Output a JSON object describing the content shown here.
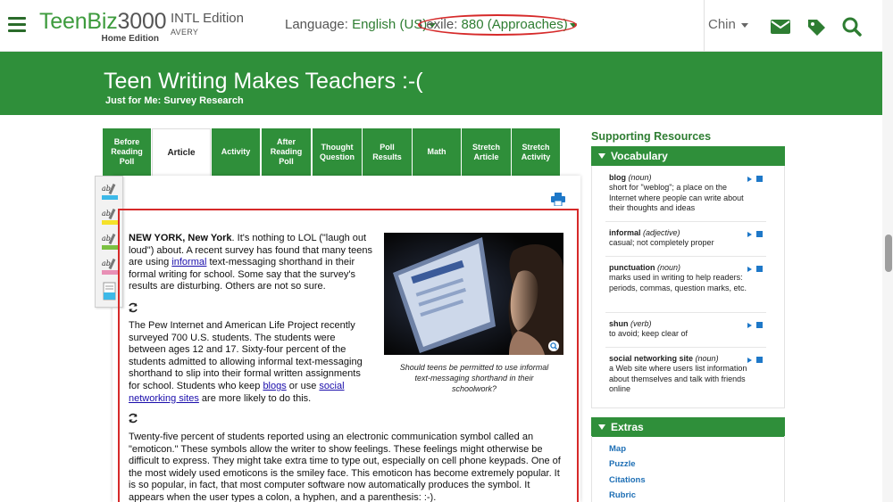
{
  "header": {
    "logo_main": "TeenBiz",
    "logo_num": "3000",
    "logo_sub": "Home Edition",
    "edition": "INTL Edition",
    "edition_sub": "AVERY",
    "language_label": "Language:",
    "language_value": "English (US)",
    "lexile_label": "Lexile:",
    "lexile_value": "880 (Approaches)",
    "user_name": "Chin",
    "icons": [
      "menu-icon",
      "mail-icon",
      "tag-icon",
      "search-icon"
    ]
  },
  "banner": {
    "title": "Teen Writing Makes Teachers :-(",
    "subtitle": "Just for Me: Survey Research"
  },
  "tabs": [
    {
      "label": "Before Reading Poll"
    },
    {
      "label": "Article"
    },
    {
      "label": "Activity"
    },
    {
      "label": "After Reading Poll"
    },
    {
      "label": "Thought Question"
    },
    {
      "label": "Poll Results"
    },
    {
      "label": "Math"
    },
    {
      "label": "Stretch Article"
    },
    {
      "label": "Stretch Activity"
    }
  ],
  "tools": {
    "colors": [
      "#3db9e8",
      "#f5e12a",
      "#7bc142",
      "#e88fb5",
      "#3db9e8"
    ]
  },
  "article": {
    "p1_dateline": "NEW YORK, New York",
    "p1_a": ". It's nothing to LOL (\"laugh out loud\") about. A recent survey has found that many teens are using ",
    "p1_link": "informal",
    "p1_b": " text-messaging shorthand in their formal writing for school. Some say that the survey's results are disturbing. Others are not so sure.",
    "p2_a": "The Pew Internet and American Life Project recently surveyed 700 U.S. students. The students were between ages 12 and 17. Sixty-four percent of the students admitted to allowing informal text-messaging shorthand to slip into their formal written assignments for school. Students who keep ",
    "p2_link1": "blogs",
    "p2_b": " or use ",
    "p2_link2": "social networking sites",
    "p2_c": " are more likely to do this.",
    "p3": "Twenty-five percent of students reported using an electronic communication symbol called an \"emoticon.\" These symbols allow the writer to show feelings. These feelings might otherwise be difficult to express. They might take extra time to type out, especially on cell phone keypads. One of the most widely used emoticons is the smiley face. This emoticon has become extremely popular. It is so popular, in fact, that most computer software now automatically produces the symbol. It appears when the user types a colon, a hyphen, and a parenthesis: :-).",
    "caption": "Should teens be permitted to use informal text-messaging shorthand in their schoolwork?"
  },
  "resources": {
    "title": "Supporting Resources",
    "vocab_head": "Vocabulary",
    "vocab": [
      {
        "word": "blog",
        "pos": "(noun)",
        "def": "short for \"weblog\"; a place on the Internet where people can write about their thoughts and ideas"
      },
      {
        "word": "informal",
        "pos": "(adjective)",
        "def": "casual; not completely proper"
      },
      {
        "word": "punctuation",
        "pos": "(noun)",
        "def": "marks used in writing to help readers: periods, commas, question marks, etc."
      },
      {
        "word": "shun",
        "pos": "(verb)",
        "def": "to avoid; keep clear of"
      },
      {
        "word": "social networking site",
        "pos": "(noun)",
        "def": "a Web site where users list information about themselves and talk with friends online"
      }
    ],
    "extras_head": "Extras",
    "extras": [
      "Map",
      "Puzzle",
      "Citations",
      "Rubric"
    ]
  },
  "colors": {
    "brand_green": "#2f8f3a",
    "highlight_red": "#d62a2a",
    "link_blue": "#1a0dab",
    "audio_blue": "#1e78c8"
  }
}
